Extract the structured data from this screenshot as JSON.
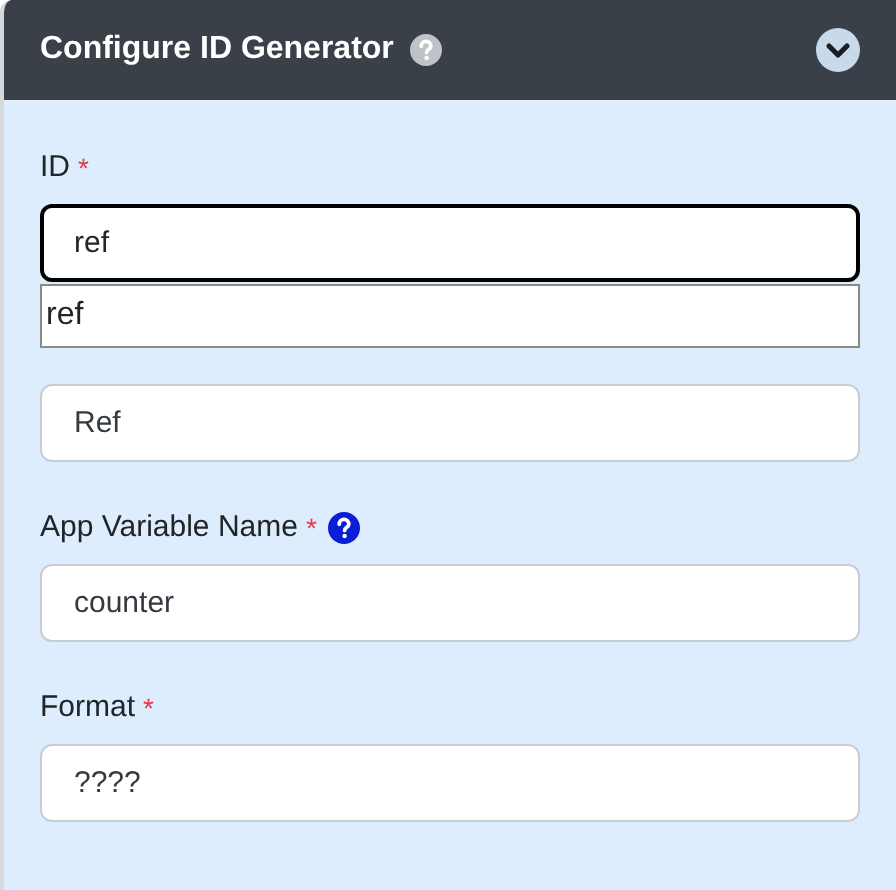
{
  "panel": {
    "title": "Configure ID Generator",
    "help": true
  },
  "fields": [
    {
      "label": "ID",
      "required_mark": "*",
      "help": false,
      "value": "ref",
      "focused": true,
      "suggestions": [
        "ref"
      ]
    },
    {
      "help": false,
      "value": "Ref",
      "focused": false
    },
    {
      "label": "App Variable Name",
      "required_mark": "*",
      "help": true,
      "value": "counter",
      "focused": false
    },
    {
      "label": "Format",
      "required_mark": "*",
      "help": false,
      "value": "????",
      "focused": false
    }
  ]
}
